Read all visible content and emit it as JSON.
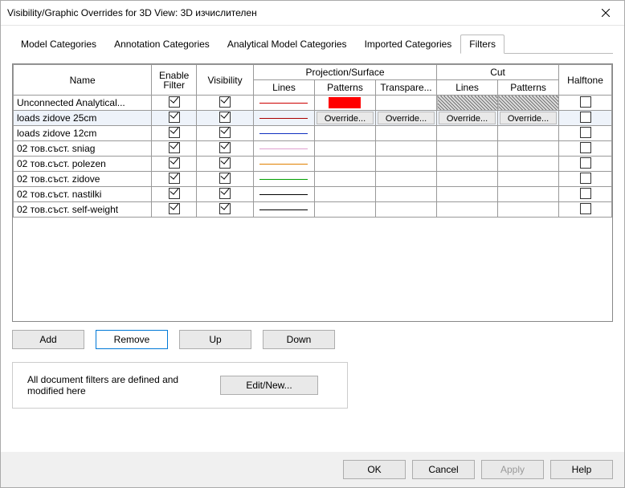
{
  "title": "Visibility/Graphic Overrides for 3D View: 3D изчислителен",
  "tabs": [
    "Model Categories",
    "Annotation Categories",
    "Analytical Model Categories",
    "Imported Categories",
    "Filters"
  ],
  "columns": {
    "name": "Name",
    "enable": "Enable Filter",
    "visibility": "Visibility",
    "projection": "Projection/Surface",
    "cut": "Cut",
    "lines": "Lines",
    "patterns": "Patterns",
    "transparency": "Transpare...",
    "halftone": "Halftone"
  },
  "overrideLabel": "Override...",
  "rows": [
    {
      "name": "Unconnected Analytical...",
      "enable": true,
      "visible": true,
      "lineColor": "#cc0000",
      "pattern": "#ff0000",
      "selected": false,
      "cutHatch": true,
      "halftone": false
    },
    {
      "name": "loads zidove 25cm",
      "enable": true,
      "visible": true,
      "lineColor": "#aa0000",
      "selected": true,
      "showOverrides": true,
      "halftone": false
    },
    {
      "name": "loads zidove 12cm",
      "enable": true,
      "visible": true,
      "lineColor": "#1030c0",
      "halftone": false
    },
    {
      "name": "02 тов.съст. sniag",
      "enable": true,
      "visible": true,
      "lineColor": "#e0a0d0",
      "halftone": false
    },
    {
      "name": "02 тов.съст. polezen",
      "enable": true,
      "visible": true,
      "lineColor": "#e08000",
      "halftone": false
    },
    {
      "name": "02 тов.съст. zidove",
      "enable": true,
      "visible": true,
      "lineColor": "#00a000",
      "halftone": false
    },
    {
      "name": "02 тов.съст. nastilki",
      "enable": true,
      "visible": true,
      "lineColor": "#000000",
      "halftone": false
    },
    {
      "name": "02 тов.съст. self-weight",
      "enable": true,
      "visible": true,
      "lineColor": "#000000",
      "halftone": false
    }
  ],
  "buttons": {
    "add": "Add",
    "remove": "Remove",
    "up": "Up",
    "down": "Down",
    "editNew": "Edit/New...",
    "ok": "OK",
    "cancel": "Cancel",
    "apply": "Apply",
    "help": "Help"
  },
  "docText": "All document filters are defined and modified here"
}
